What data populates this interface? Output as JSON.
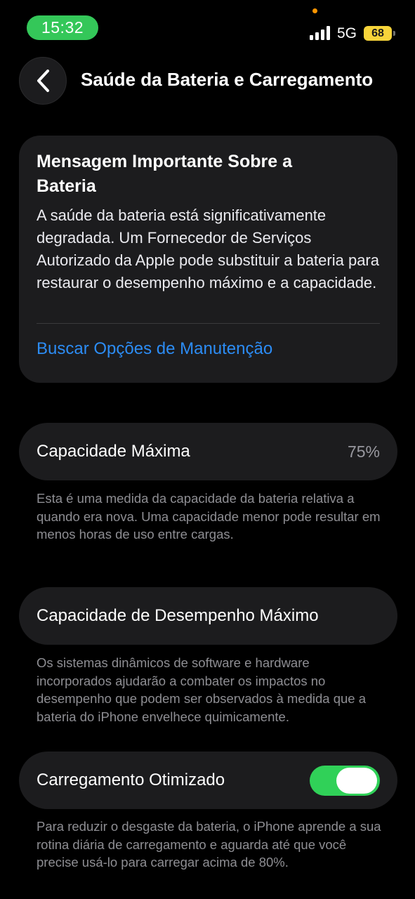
{
  "status_bar": {
    "time": "15:32",
    "network": "5G",
    "battery_level": "68"
  },
  "nav": {
    "title": "Saúde da Bateria e Carregamento"
  },
  "message": {
    "title": "Mensagem Importante Sobre a Bateria",
    "body": "A saúde da bateria está significativamente degradada. Um Fornecedor de Serviços Autorizado da Apple pode substituir a bateria para restaurar o desempenho máximo e a capacidade.",
    "link": "Buscar Opções de Manutenção"
  },
  "max_capacity": {
    "label": "Capacidade Máxima",
    "value": "75%",
    "footnote": "Esta é uma medida da capacidade da bateria relativa a quando era nova. Uma capacidade menor pode resultar em menos horas de uso entre cargas."
  },
  "peak_performance": {
    "label": "Capacidade de Desempenho Máximo",
    "footnote": "Os sistemas dinâmicos de software e hardware incorporados ajudarão a combater os impactos no desempenho que podem ser observados à medida que a bateria do iPhone envelhece quimicamente."
  },
  "optimized_charging": {
    "label": "Carregamento Otimizado",
    "enabled": true,
    "footnote": "Para reduzir o desgaste da bateria, o iPhone aprende a sua rotina diária de carregamento e aguarda até que você precise usá-lo para carregar acima de 80%."
  },
  "colors": {
    "background": "#000000",
    "card": "#1c1c1e",
    "accent_link": "#2c8cf4",
    "toggle_on": "#30d158",
    "time_pill": "#34c759",
    "battery": "#f7d43a"
  },
  "icons": {
    "back": "chevron-left-icon",
    "signal": "cellular-signal-icon",
    "battery": "battery-icon"
  }
}
